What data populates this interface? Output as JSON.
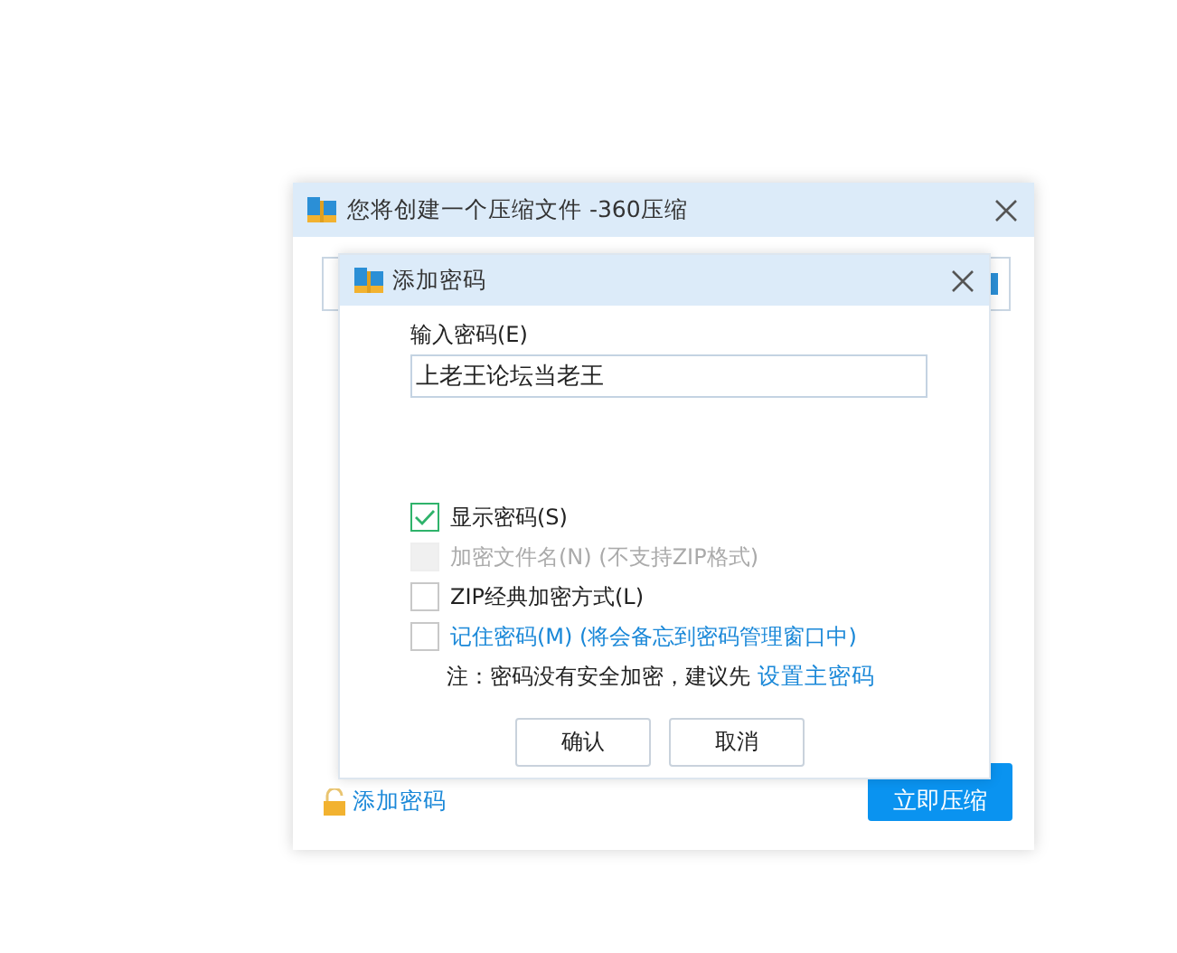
{
  "main_window": {
    "title": "您将创建一个压缩文件 -360压缩",
    "add_password_link": "添加密码",
    "compress_button": "立即压缩"
  },
  "dialog": {
    "title": "添加密码",
    "password_label": "输入密码(E)",
    "password_value": "上老王论坛当老王",
    "options": [
      {
        "label": "显示密码(S)",
        "checked": true,
        "disabled": false,
        "link": false
      },
      {
        "label": "加密文件名(N) (不支持ZIP格式)",
        "checked": false,
        "disabled": true,
        "link": false
      },
      {
        "label": "ZIP经典加密方式(L)",
        "checked": false,
        "disabled": false,
        "link": false
      },
      {
        "label": "记住密码(M) (将会备忘到密码管理窗口中)",
        "checked": false,
        "disabled": false,
        "link": true
      }
    ],
    "note": "注：密码没有安全加密，建议先",
    "note_link": "设置主密码",
    "buttons": [
      "确认",
      "取消"
    ]
  }
}
